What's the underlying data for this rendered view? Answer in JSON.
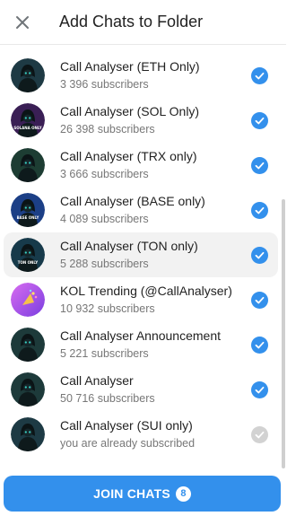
{
  "header": {
    "title": "Add Chats to Folder",
    "close_icon": "close-icon"
  },
  "chats": [
    {
      "title": "Call Analyser (ETH Only)",
      "subtitle": "3 396 subscribers",
      "checked": true,
      "avatar_color": "#1e3a44",
      "badge": ""
    },
    {
      "title": "Call Analyser (SOL Only)",
      "subtitle": "26 398 subscribers",
      "checked": true,
      "avatar_color": "#3a1f55",
      "badge": "SOLANA ONLY"
    },
    {
      "title": "Call Analyser (TRX only)",
      "subtitle": "3 666 subscribers",
      "checked": true,
      "avatar_color": "#1d3d33",
      "badge": ""
    },
    {
      "title": "Call Analyser (BASE only)",
      "subtitle": "4 089 subscribers",
      "checked": true,
      "avatar_color": "#1c3f86",
      "badge": "BASE ONLY"
    },
    {
      "title": "Call Analyser (TON only)",
      "subtitle": "5 288 subscribers",
      "checked": true,
      "avatar_color": "#173a4a",
      "badge": "TON ONLY"
    },
    {
      "title": "KOL Trending (@CallAnalyser)",
      "subtitle": "10 932 subscribers",
      "checked": true,
      "avatar_color": "#b84fe0",
      "badge": ""
    },
    {
      "title": "Call Analyser Announcement",
      "subtitle": "5 221 subscribers",
      "checked": true,
      "avatar_color": "#1d3a3a",
      "badge": ""
    },
    {
      "title": "Call Analyser",
      "subtitle": "50 716 subscribers",
      "checked": true,
      "avatar_color": "#1d3a3a",
      "badge": ""
    },
    {
      "title": "Call Analyser (SUI only)",
      "subtitle": "you are already subscribed",
      "checked": false,
      "avatar_color": "#1d3a44",
      "badge": ""
    }
  ],
  "join": {
    "label": "JOIN CHATS",
    "count": "8"
  },
  "colors": {
    "accent": "#3390ec",
    "disabled_check": "#d2d2d2"
  }
}
